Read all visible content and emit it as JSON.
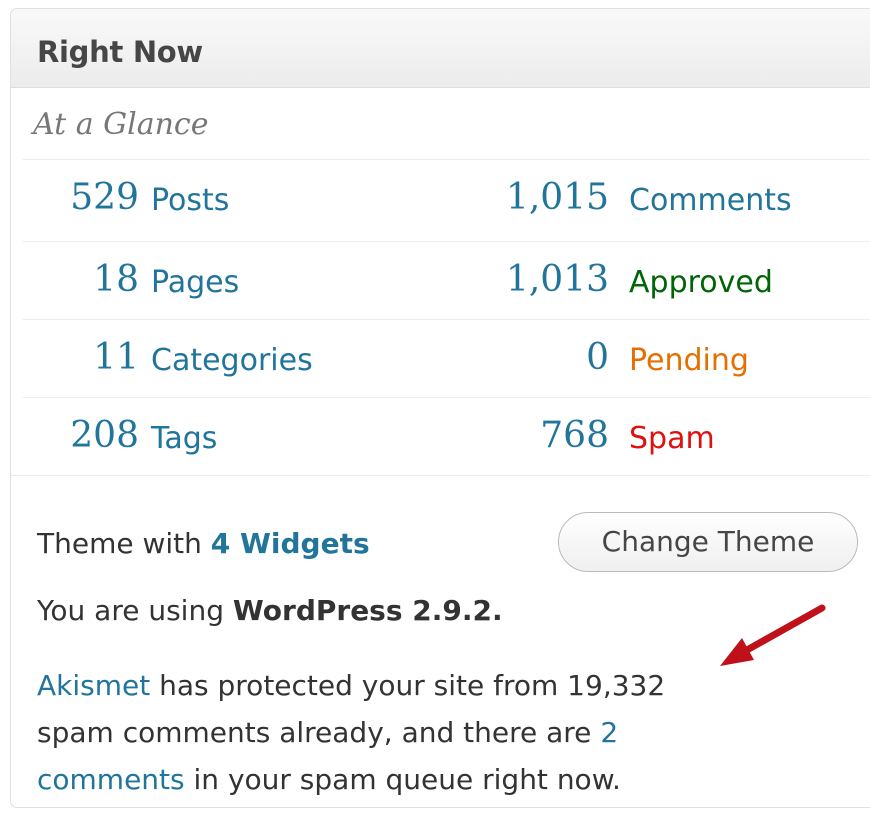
{
  "header": {
    "title": "Right Now"
  },
  "glance": {
    "title": "At a Glance"
  },
  "left_stats": [
    {
      "num": "529",
      "label": "Posts"
    },
    {
      "num": "18",
      "label": "Pages"
    },
    {
      "num": "11",
      "label": "Categories"
    },
    {
      "num": "208",
      "label": "Tags"
    }
  ],
  "right_stats": [
    {
      "num": "1,015",
      "label": "Comments"
    },
    {
      "num": "1,013",
      "label": "Approved"
    },
    {
      "num": "0",
      "label": "Pending"
    },
    {
      "num": "768",
      "label": "Spam"
    }
  ],
  "theme": {
    "prefix": "Theme with ",
    "widgets_link": "4 Widgets",
    "change_button": "Change Theme"
  },
  "version": {
    "prefix": "You are using ",
    "name": "WordPress 2.9.2."
  },
  "akismet": {
    "link": "Akismet",
    "text1": " has protected your site from 19,332",
    "text2": "spam comments already, and there are ",
    "count_link": "2",
    "comments_link": "comments",
    "text3": " in your spam queue right now."
  },
  "colors": {
    "link": "#21759b",
    "approved": "#006505",
    "pending": "#e66f00",
    "spam": "#e01010",
    "arrow": "#c0101a"
  },
  "icons": {
    "annotation": "red-arrow-icon"
  }
}
